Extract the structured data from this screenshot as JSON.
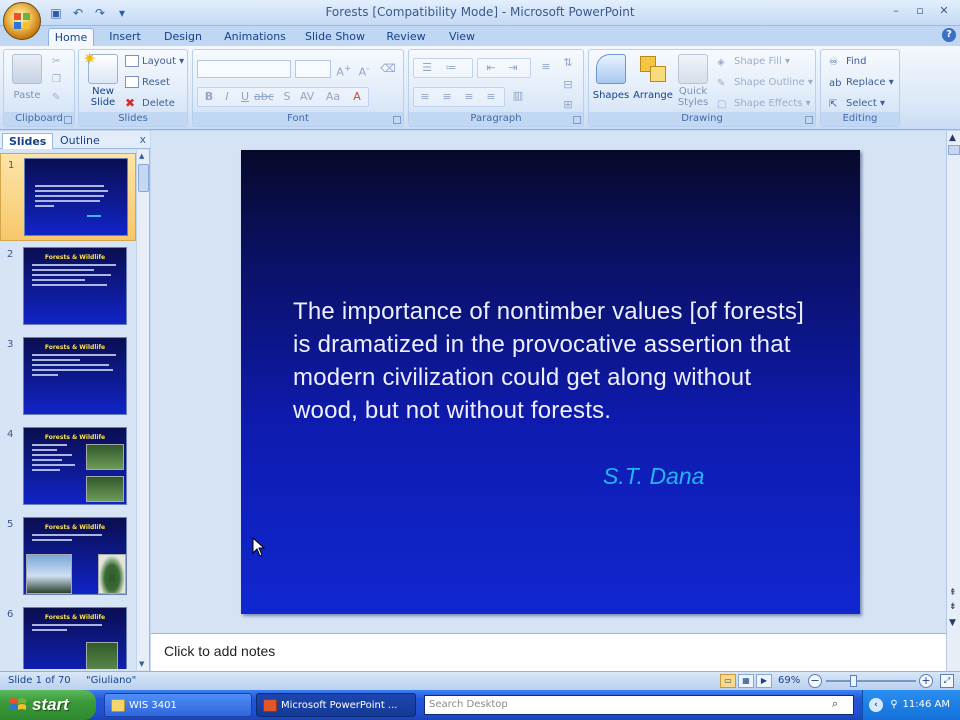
{
  "window": {
    "title": "Forests [Compatibility Mode] - Microsoft PowerPoint",
    "controls": [
      "–",
      "▫",
      "✕"
    ]
  },
  "ribbon": {
    "tabs": [
      "Home",
      "Insert",
      "Design",
      "Animations",
      "Slide Show",
      "Review",
      "View"
    ],
    "active_tab": "Home",
    "groups": {
      "clipboard": {
        "label": "Clipboard",
        "paste": "Paste"
      },
      "slides": {
        "label": "Slides",
        "new_slide": "New\nSlide",
        "new_slide_line1": "New",
        "new_slide_line2": "Slide",
        "layout": "Layout",
        "reset": "Reset",
        "delete": "Delete"
      },
      "font": {
        "label": "Font"
      },
      "paragraph": {
        "label": "Paragraph"
      },
      "drawing": {
        "label": "Drawing",
        "shapes": "Shapes",
        "arrange": "Arrange",
        "quick_styles_line1": "Quick",
        "quick_styles_line2": "Styles",
        "shape_fill": "Shape Fill",
        "shape_outline": "Shape Outline",
        "shape_effects": "Shape Effects"
      },
      "editing": {
        "label": "Editing",
        "find": "Find",
        "replace": "Replace",
        "select": "Select"
      }
    }
  },
  "left_pane": {
    "tabs": [
      "Slides",
      "Outline"
    ],
    "active_tab": "Slides",
    "close": "x",
    "slides": [
      {
        "num": "1",
        "title": "",
        "selected": true
      },
      {
        "num": "2",
        "title": "Forests & Wildlife"
      },
      {
        "num": "3",
        "title": "Forests & Wildlife"
      },
      {
        "num": "4",
        "title": "Forests & Wildlife"
      },
      {
        "num": "5",
        "title": "Forests & Wildlife"
      },
      {
        "num": "6",
        "title": "Forests & Wildlife"
      }
    ]
  },
  "slide": {
    "body": "The importance of nontimber values [of forests] is dramatized in the provocative assertion that modern civilization could get along without wood, but not without forests.",
    "author": "S.T. Dana",
    "background_top": "#07092a",
    "background_bottom": "#1027d0",
    "author_color": "#22b7f2"
  },
  "notes": {
    "placeholder": "Click to add notes"
  },
  "status_bar": {
    "slide_position": "Slide 1 of 70",
    "theme": "\"Giuliano\"",
    "zoom": "69%"
  },
  "taskbar": {
    "start": "start",
    "tasks": [
      "WIS 3401",
      "Microsoft PowerPoint ..."
    ],
    "search_placeholder": "Search Desktop",
    "clock": "11:46 AM"
  }
}
